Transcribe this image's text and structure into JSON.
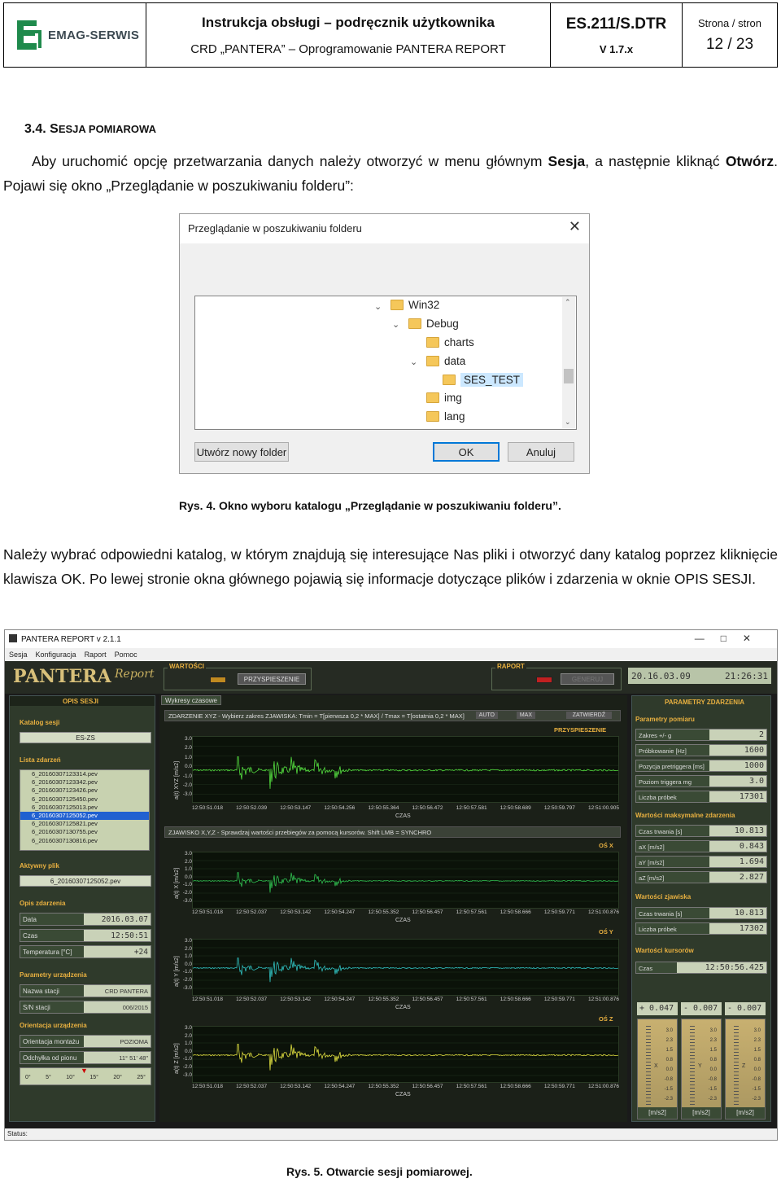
{
  "header": {
    "company": "EMAG-SERWIS",
    "title": "Instrukcja obsługi – podręcznik użytkownika",
    "subtitle": "CRD „PANTERA” – Oprogramowanie PANTERA REPORT",
    "doc_code": "ES.211/S.DTR",
    "version": "V 1.7.x",
    "page_label": "Strona / stron",
    "page_value": "12 / 23"
  },
  "section": {
    "number": "3.4.",
    "title_first": "S",
    "title_rest": "ESJA POMIAROWA"
  },
  "para1": {
    "t1": "Aby uruchomić opcję przetwarzania danych należy otworzyć w menu głównym ",
    "b1": "Sesja",
    "t2": ", a następnie kliknąć ",
    "b2": "Otwórz",
    "t3": ". Pojawi się okno „Przeglądanie w poszukiwaniu folderu”:"
  },
  "dialog": {
    "title": "Przeglądanie w poszukiwaniu folderu",
    "close": "✕",
    "items": [
      "Win32",
      "Debug",
      "charts",
      "data",
      "SES_TEST",
      "img",
      "lang"
    ],
    "btn_new": "Utwórz nowy folder",
    "btn_ok": "OK",
    "btn_cancel": "Anuluj"
  },
  "caption1": "Rys. 4. Okno wyboru katalogu „Przeglądanie w poszukiwaniu folderu”.",
  "para2": "Należy wybrać odpowiedni katalog, w którym znajdują się interesujące Nas pliki i otworzyć dany katalog poprzez kliknięcie klawisza OK. Po lewej stronie okna głównego pojawią się  informacje dotyczące plików i zdarzenia w oknie OPIS SESJI.",
  "app": {
    "title": "PANTERA REPORT v 2.1.1",
    "menu": [
      "Sesja",
      "Konfiguracja",
      "Raport",
      "Pomoc"
    ],
    "brand": "PANTERA",
    "brand_script": "Report",
    "grp_values": "WARTOŚCI",
    "btn_accel": "PRZYSPIESZENIE",
    "grp_report": "RAPORT",
    "btn_generate": "GENERUJ",
    "lcd_date": "20.16.03.09",
    "lcd_time": "21:26:31",
    "left": {
      "head": "OPIS SESJI",
      "katalog_label": "Katalog sesji",
      "katalog": "ES-ZS",
      "lista_label": "Lista zdarzeń",
      "files": [
        "6_20160307123314.pev",
        "6_20160307123342.pev",
        "6_20160307123426.pev",
        "6_20160307125450.pev",
        "6_20160307125013.pev",
        "6_20160307125052.pev",
        "6_20160307125821.pev",
        "6_20160307130755.pev",
        "6_20160307130816.pev"
      ],
      "selected_index": 5,
      "aktywny_label": "Aktywny plik",
      "aktywny": "6_20160307125052.pev",
      "opis_label": "Opis zdarzenia",
      "data_k": "Data",
      "data_v": "2016.03.07",
      "czas_k": "Czas",
      "czas_v": "12:50:51",
      "temp_k": "Temperatura [°C]",
      "temp_v": "+24",
      "param_label": "Parametry urządzenia",
      "nazwa_k": "Nazwa stacji",
      "nazwa_v": "CRD PANTERA",
      "sn_k": "S/N stacji",
      "sn_v": "006/2015",
      "orient_label": "Orientacja urządzenia",
      "om_k": "Orientacja montażu",
      "om_v": "POZIOMA",
      "odch_k": "Odchyłka od pionu",
      "odch_v": "11° 51' 48\"",
      "ruler": [
        "0°",
        "5°",
        "10°",
        "15°",
        "20°",
        "25°"
      ]
    },
    "mid": {
      "tab": "Wykresy czasowe",
      "bar1": "ZDARZENIE XYZ - Wybierz zakres ZJAWISKA: Tmin = T[pierwsza 0,2 * MAX] / Tmax = T[ostatnia 0,2 * MAX]",
      "btn_auto": "AUTO",
      "btn_max": "MAX",
      "btn_confirm": "ZATWIERDŹ",
      "acc": "PRZYSPIESZENIE",
      "bar2": "ZJAWISKO X,Y,Z - Sprawdzaj wartości przebiegów za pomocą kursorów. Shift LMB = SYNCHRO",
      "osx": "OŚ X",
      "osy": "OŚ Y",
      "osz": "OŚ Z",
      "czas": "CZAS",
      "yl_xyz": "a(t) XYZ [m/s2]",
      "yl_x": "a(t) X [m/s2]",
      "yl_y": "a(t) Y [m/s2]",
      "yl_z": "a(t) Z [m/s2]",
      "yticks": [
        "3.0",
        "2.0",
        "1.0",
        "0.0",
        "-1.0",
        "-2.0",
        "-3.0"
      ],
      "xticks1": [
        "12:50:51.018",
        "12:50:52.039",
        "12:50:53.147",
        "12:50:54.256",
        "12:50:55.364",
        "12:50:56.472",
        "12:50:57.581",
        "12:50:58.689",
        "12:50:59.797",
        "12:51:00.905"
      ],
      "xticks2": [
        "12:50:51.018",
        "12:50:52.037",
        "12:50:53.142",
        "12:50:54.247",
        "12:50:55.352",
        "12:50:56.457",
        "12:50:57.561",
        "12:50:58.666",
        "12:50:59.771",
        "12:51:00.876"
      ]
    },
    "right": {
      "head": "PARAMETRY ZDARZENIA",
      "pp_label": "Parametry pomiaru",
      "zakres_k": "Zakres +/- g",
      "zakres_v": "2",
      "probk_k": "Próbkowanie [Hz]",
      "probk_v": "1600",
      "pozpre_k": "Pozycja pretriggera [ms]",
      "pozpre_v": "1000",
      "poztrig_k": "Poziom triggera mg",
      "poztrig_v": "3.0",
      "liczba_k": "Liczba próbek",
      "liczba_v": "17301",
      "wmax_label": "Wartości maksymalne zdarzenia",
      "ct_k": "Czas trwania [s]",
      "ct_v": "10.813",
      "ax_k": "aX [m/s2]",
      "ax_v": "0.843",
      "ay_k": "aY [m/s2]",
      "ay_v": "1.694",
      "az_k": "aZ [m/s2]",
      "az_v": "2.827",
      "wz_label": "Wartości zjawiska",
      "ctz_k": "Czas trwania [s]",
      "ctz_v": "10.813",
      "lp_k": "Liczba próbek",
      "lp_v": "17302",
      "wk_label": "Wartości kursorów",
      "czas_k": "Czas",
      "czas_v": "12:50:56.425",
      "m1": "+ 0.047",
      "m2": "- 0.007",
      "m3": "- 0.007",
      "mscale": [
        "3.0",
        "2.3",
        "1.5",
        "0.8",
        "0.0",
        "-0.8",
        "-1.5",
        "-2.3",
        "-3.0"
      ],
      "munit": "[m/s2]",
      "mx": "X",
      "my": "Y",
      "mz": "Z"
    },
    "status": "Status:"
  },
  "caption2": "Rys. 5. Otwarcie sesji pomiarowej."
}
